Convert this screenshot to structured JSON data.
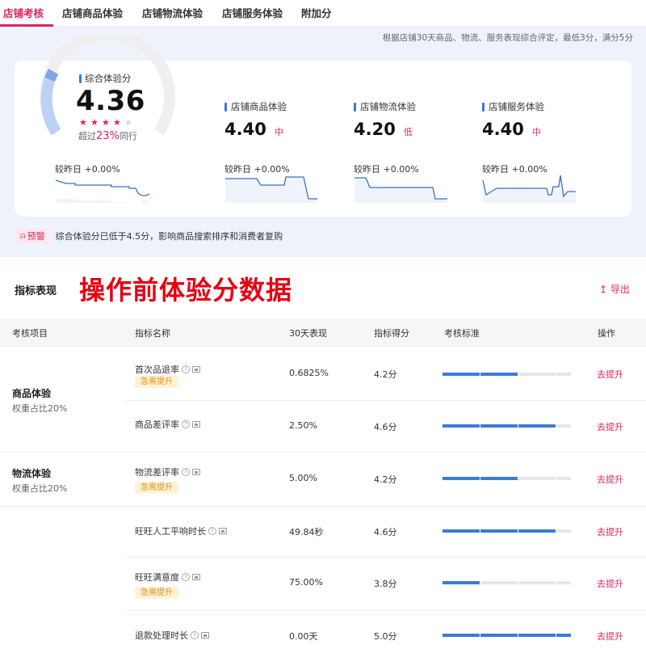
{
  "tabs": [
    "店铺考核",
    "店铺商品体验",
    "店铺物流体验",
    "店铺服务体验",
    "附加分"
  ],
  "score_note": "根据店铺30天商品、物流、服务表现综合评定，最低3分，满分5分",
  "overall": {
    "label": "综合体验分",
    "score": "4.36",
    "stars_on": 4,
    "stars_total": 5,
    "exceed_prefix": "超过",
    "exceed_pct": "23%",
    "exceed_suffix": "同行",
    "compare": "较昨日 +0.00%"
  },
  "subs": [
    {
      "title": "店铺商品体验",
      "score": "4.40",
      "level": "中",
      "compare": "较昨日 +0.00%"
    },
    {
      "title": "店铺物流体验",
      "score": "4.20",
      "level": "低",
      "compare": "较昨日 +0.00%"
    },
    {
      "title": "店铺服务体验",
      "score": "4.40",
      "level": "中",
      "compare": "较昨日 +0.00%"
    }
  ],
  "warning": {
    "badge": "预警",
    "text": "综合体验分已低于4.5分，影响商品搜索排序和消费者复购"
  },
  "section": {
    "title": "指标表现",
    "banner": "操作前体验分数据",
    "export": "导出"
  },
  "table": {
    "headers": [
      "考核项目",
      "指标名称",
      "30天表现",
      "指标得分",
      "考核标准",
      "操作"
    ],
    "groups": [
      {
        "name": "商品体验",
        "weight": "权重占比20%"
      },
      {
        "name": "物流体验",
        "weight": "权重占比20%"
      }
    ],
    "rows": [
      {
        "name": "首次品退率",
        "tag": "急需提升",
        "perf": "0.6825%",
        "score": "4.2分",
        "level": 2,
        "action": "去提升"
      },
      {
        "name": "商品差评率",
        "tag": "",
        "perf": "2.50%",
        "score": "4.6分",
        "level": 3,
        "action": "去提升"
      },
      {
        "name": "物流差评率",
        "tag": "急需提升",
        "perf": "5.00%",
        "score": "4.2分",
        "level": 2,
        "action": "去提升"
      },
      {
        "name": "旺旺人工平响时长",
        "tag": "",
        "perf": "49.84秒",
        "score": "4.6分",
        "level": 3,
        "action": "去提升"
      },
      {
        "name": "旺旺满意度",
        "tag": "急需提升",
        "perf": "75.00%",
        "score": "3.8分",
        "level": 1,
        "action": "去提升"
      },
      {
        "name": "退款处理时长",
        "tag": "",
        "perf": "0.00天",
        "score": "5.0分",
        "level": 4,
        "action": "去提升"
      }
    ]
  },
  "colors": {
    "accent": "#e0245e",
    "blue": "#3b7bd6",
    "banner": "#e60012",
    "tag_bg": "#fff2d6",
    "tag_text": "#e8901a"
  }
}
